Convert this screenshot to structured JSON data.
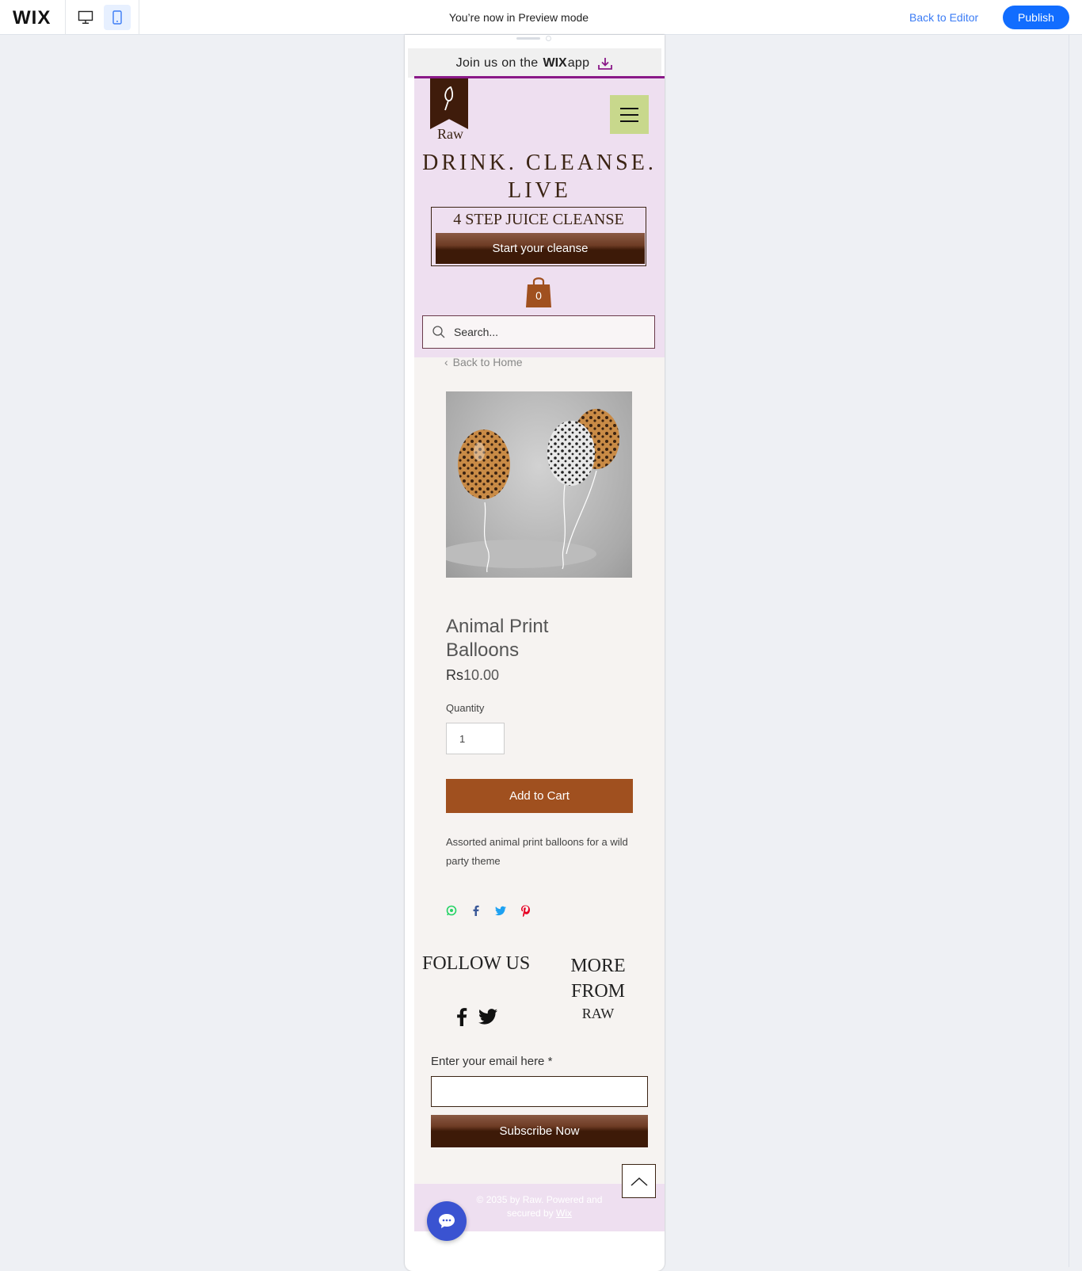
{
  "editor": {
    "logo": "WIX",
    "preview_message": "You’re now in Preview mode",
    "back_to_editor": "Back to Editor",
    "publish": "Publish",
    "accent": "#116dff"
  },
  "app_banner": {
    "prefix": "Join us on the",
    "brand": "WIX",
    "suffix": "app",
    "accent": "#8a1a88"
  },
  "header": {
    "logo_text": "Raw",
    "tagline": "DRINK. CLEANSE. LIVE",
    "promo_title": "4 STEP JUICE CLEANSE",
    "promo_button": "Start your cleanse",
    "cart_count": "0",
    "search_placeholder": "Search..."
  },
  "product": {
    "back_link": "Back to Home",
    "name": "Animal Print Balloons",
    "price_currency": "Rs",
    "price_value": "10.00",
    "quantity_label": "Quantity",
    "quantity_value": "1",
    "add_to_cart": "Add to Cart",
    "description": "Assorted animal print balloons for a wild party theme",
    "accent": "#a0501f"
  },
  "footer": {
    "follow_title": "FOLLOW US",
    "more_title": "MORE FROM",
    "more_sub": "RAW",
    "email_label": "Enter your email here *",
    "subscribe": "Subscribe Now",
    "copyright": "© 2035 by Raw. Powered and secured by",
    "copyright_link": "Wix"
  }
}
